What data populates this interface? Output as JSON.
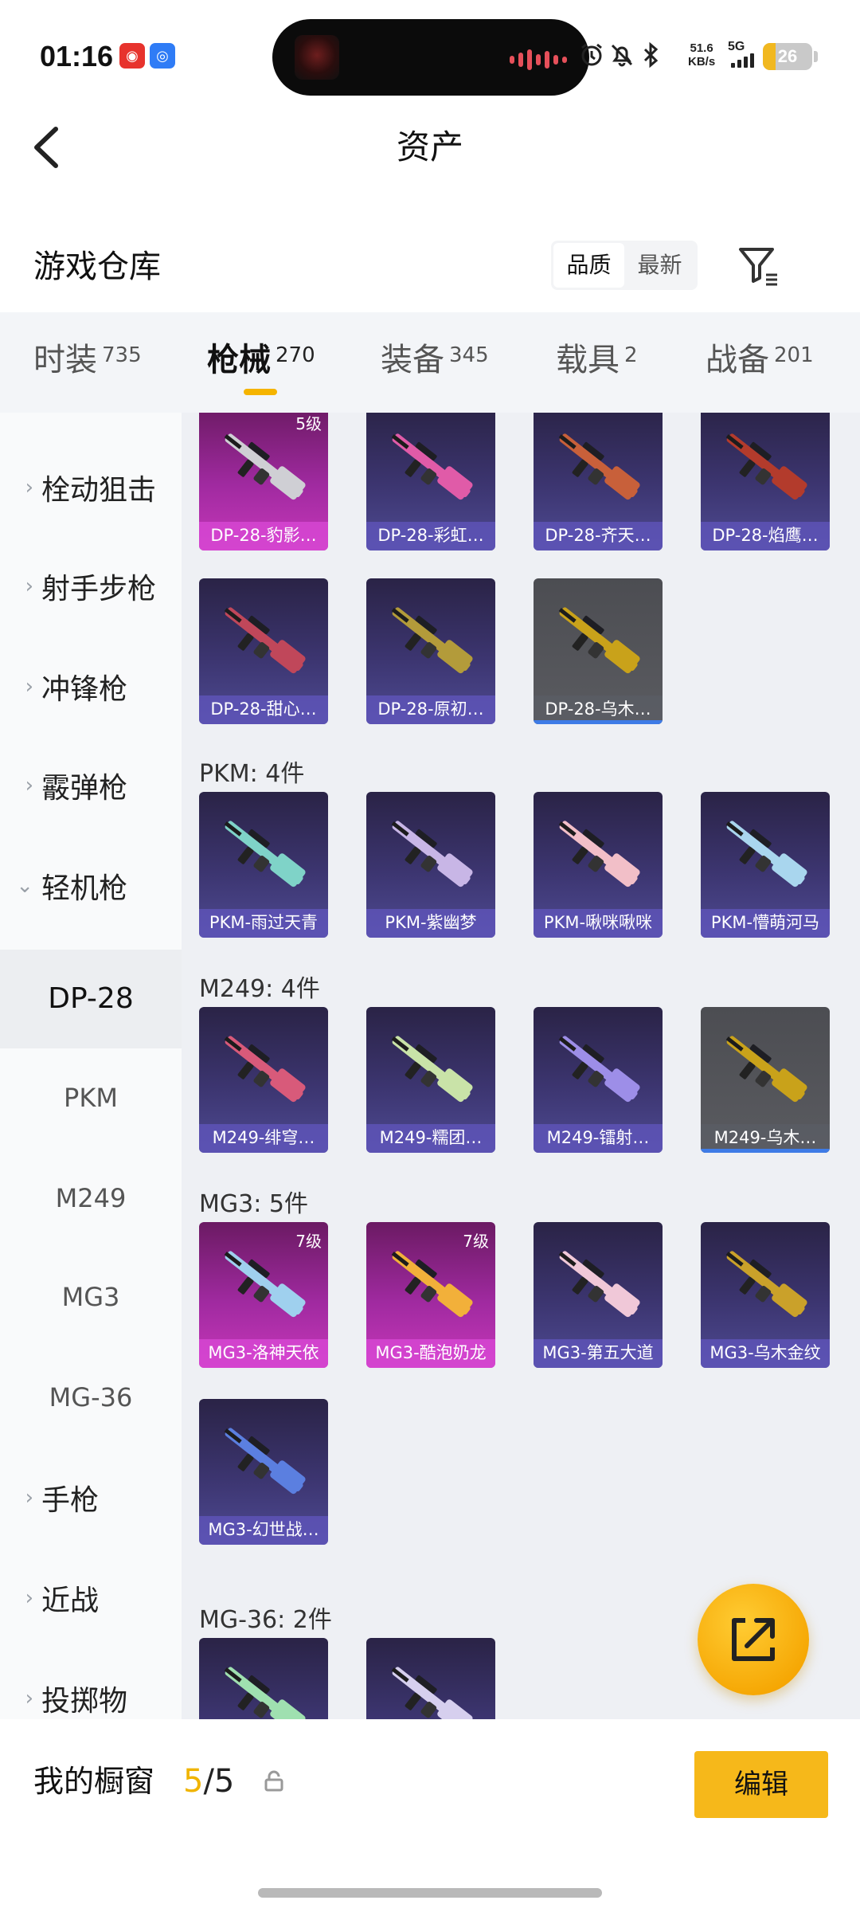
{
  "status_bar": {
    "time": "01:16",
    "net_speed_value": "51.6",
    "net_speed_unit": "KB/s",
    "network": "5G",
    "battery": "26",
    "battery_level": 0.26,
    "icons": [
      "netease-music-icon",
      "browser-app-icon",
      "alarm-icon",
      "mute-bell-icon",
      "bluetooth-icon",
      "signal-icon"
    ]
  },
  "header": {
    "title": "资产"
  },
  "section": {
    "title": "游戏仓库",
    "sort_options": [
      "品质",
      "最新"
    ],
    "sort_selected": "品质"
  },
  "tabs": [
    {
      "label": "时装",
      "count": "735"
    },
    {
      "label": "枪械",
      "count": "270",
      "active": true
    },
    {
      "label": "装备",
      "count": "345"
    },
    {
      "label": "载具",
      "count": "2"
    },
    {
      "label": "战备",
      "count": "201"
    }
  ],
  "sidebar": {
    "categories": [
      {
        "label": "栓动狙击",
        "chev": "›"
      },
      {
        "label": "射手步枪",
        "chev": "›"
      },
      {
        "label": "冲锋枪",
        "chev": "›"
      },
      {
        "label": "霰弹枪",
        "chev": "›"
      },
      {
        "label": "轻机枪",
        "chev": "⌄",
        "expanded": true
      }
    ],
    "subcategories": [
      {
        "label": "DP-28",
        "active": true
      },
      {
        "label": "PKM"
      },
      {
        "label": "M249"
      },
      {
        "label": "MG3"
      },
      {
        "label": "MG-36"
      }
    ],
    "more_categories": [
      {
        "label": "手枪",
        "chev": "›"
      },
      {
        "label": "近战",
        "chev": "›"
      },
      {
        "label": "投掷物",
        "chev": "›"
      }
    ]
  },
  "groups": [
    {
      "header": "",
      "items": [
        {
          "name": "DP-28-豹影…",
          "tier": "pink",
          "level": "5级",
          "gun_color": "#cfcfd4"
        },
        {
          "name": "DP-28-彩虹…",
          "tier": "purple",
          "gun_color": "#e05ba8"
        },
        {
          "name": "DP-28-齐天…",
          "tier": "purple",
          "gun_color": "#c8603a"
        },
        {
          "name": "DP-28-焰鹰…",
          "tier": "purple",
          "gun_color": "#b33b2c"
        },
        {
          "name": "DP-28-甜心…",
          "tier": "purple",
          "gun_color": "#c0475a"
        },
        {
          "name": "DP-28-原初…",
          "tier": "purple",
          "gun_color": "#b39b3a"
        },
        {
          "name": "DP-28-乌木…",
          "tier": "grey",
          "gun_color": "#c9a21a"
        }
      ]
    },
    {
      "header": "PKM: 4件",
      "items": [
        {
          "name": "PKM-雨过天青",
          "tier": "purple",
          "gun_color": "#7fd3c8"
        },
        {
          "name": "PKM-紫幽梦",
          "tier": "purple",
          "gun_color": "#c8b6e6"
        },
        {
          "name": "PKM-啾咪啾咪",
          "tier": "purple",
          "gun_color": "#f2bfc8"
        },
        {
          "name": "PKM-懵萌河马",
          "tier": "purple",
          "gun_color": "#a9d6ee"
        }
      ]
    },
    {
      "header": "M249: 4件",
      "items": [
        {
          "name": "M249-绯穹…",
          "tier": "purple",
          "gun_color": "#d85a7a"
        },
        {
          "name": "M249-糯团…",
          "tier": "purple",
          "gun_color": "#c9e3a8"
        },
        {
          "name": "M249-镭射…",
          "tier": "purple",
          "gun_color": "#9d8ee8"
        },
        {
          "name": "M249-乌木…",
          "tier": "grey",
          "gun_color": "#c9a21a"
        }
      ]
    },
    {
      "header": "MG3: 5件",
      "items": [
        {
          "name": "MG3-洛神天依",
          "tier": "pink",
          "level": "7级",
          "gun_color": "#9fd0ee"
        },
        {
          "name": "MG3-酷泡奶龙",
          "tier": "pink",
          "level": "7级",
          "gun_color": "#f2b03a"
        },
        {
          "name": "MG3-第五大道",
          "tier": "purple",
          "gun_color": "#f0c8d8"
        },
        {
          "name": "MG3-乌木金纹",
          "tier": "purple",
          "gun_color": "#caa12a"
        },
        {
          "name": "MG3-幻世战…",
          "tier": "purple",
          "gun_color": "#5b7fe0"
        }
      ]
    },
    {
      "header": "MG-36: 2件",
      "items": [
        {
          "name": "",
          "tier": "purple",
          "gun_color": "#9fe0b0"
        },
        {
          "name": "",
          "tier": "purple",
          "gun_color": "#d6cfee"
        }
      ]
    }
  ],
  "bottom": {
    "showcase_label": "我的橱窗",
    "showcase_current": "5",
    "showcase_total": "/5",
    "edit_label": "编辑"
  },
  "colors": {
    "accent": "#f5b400",
    "pink_tier": "#c637b9",
    "purple_tier": "#4e4a92",
    "grey_tier": "#5a5b60"
  }
}
